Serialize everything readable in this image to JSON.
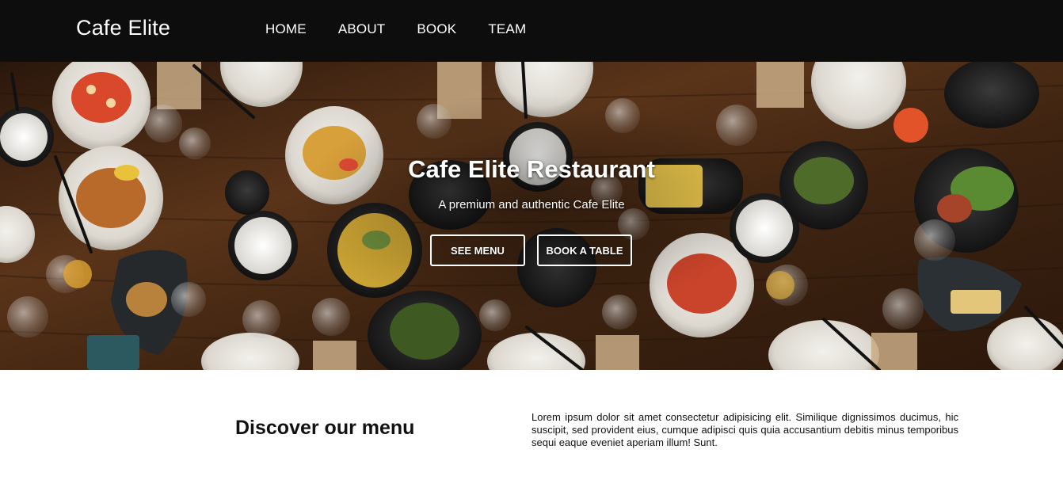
{
  "navbar": {
    "brand": "Cafe Elite",
    "links": [
      {
        "label": "HOME"
      },
      {
        "label": "ABOUT"
      },
      {
        "label": "BOOK"
      },
      {
        "label": "TEAM"
      }
    ],
    "background_color": "#0d0d0d"
  },
  "hero": {
    "title": "Cafe Elite Restaurant",
    "subtitle": "A premium and authentic Cafe Elite",
    "buttons": {
      "menu_label": "SEE MENU",
      "book_label": "BOOK A TABLE"
    },
    "background_image": "overhead-table-of-dishes"
  },
  "discover": {
    "title": "Discover our menu",
    "text": "Lorem ipsum dolor sit amet consectetur adipisicing elit. Similique dignissimos ducimus, hic suscipit, sed provident eius, cumque adipisci quis quia accusantium debitis minus temporibus sequi eaque eveniet aperiam illum! Sunt."
  },
  "colors": {
    "wood": "#4a2c17",
    "plate": "#e9e6df",
    "text_dark": "#111111"
  }
}
